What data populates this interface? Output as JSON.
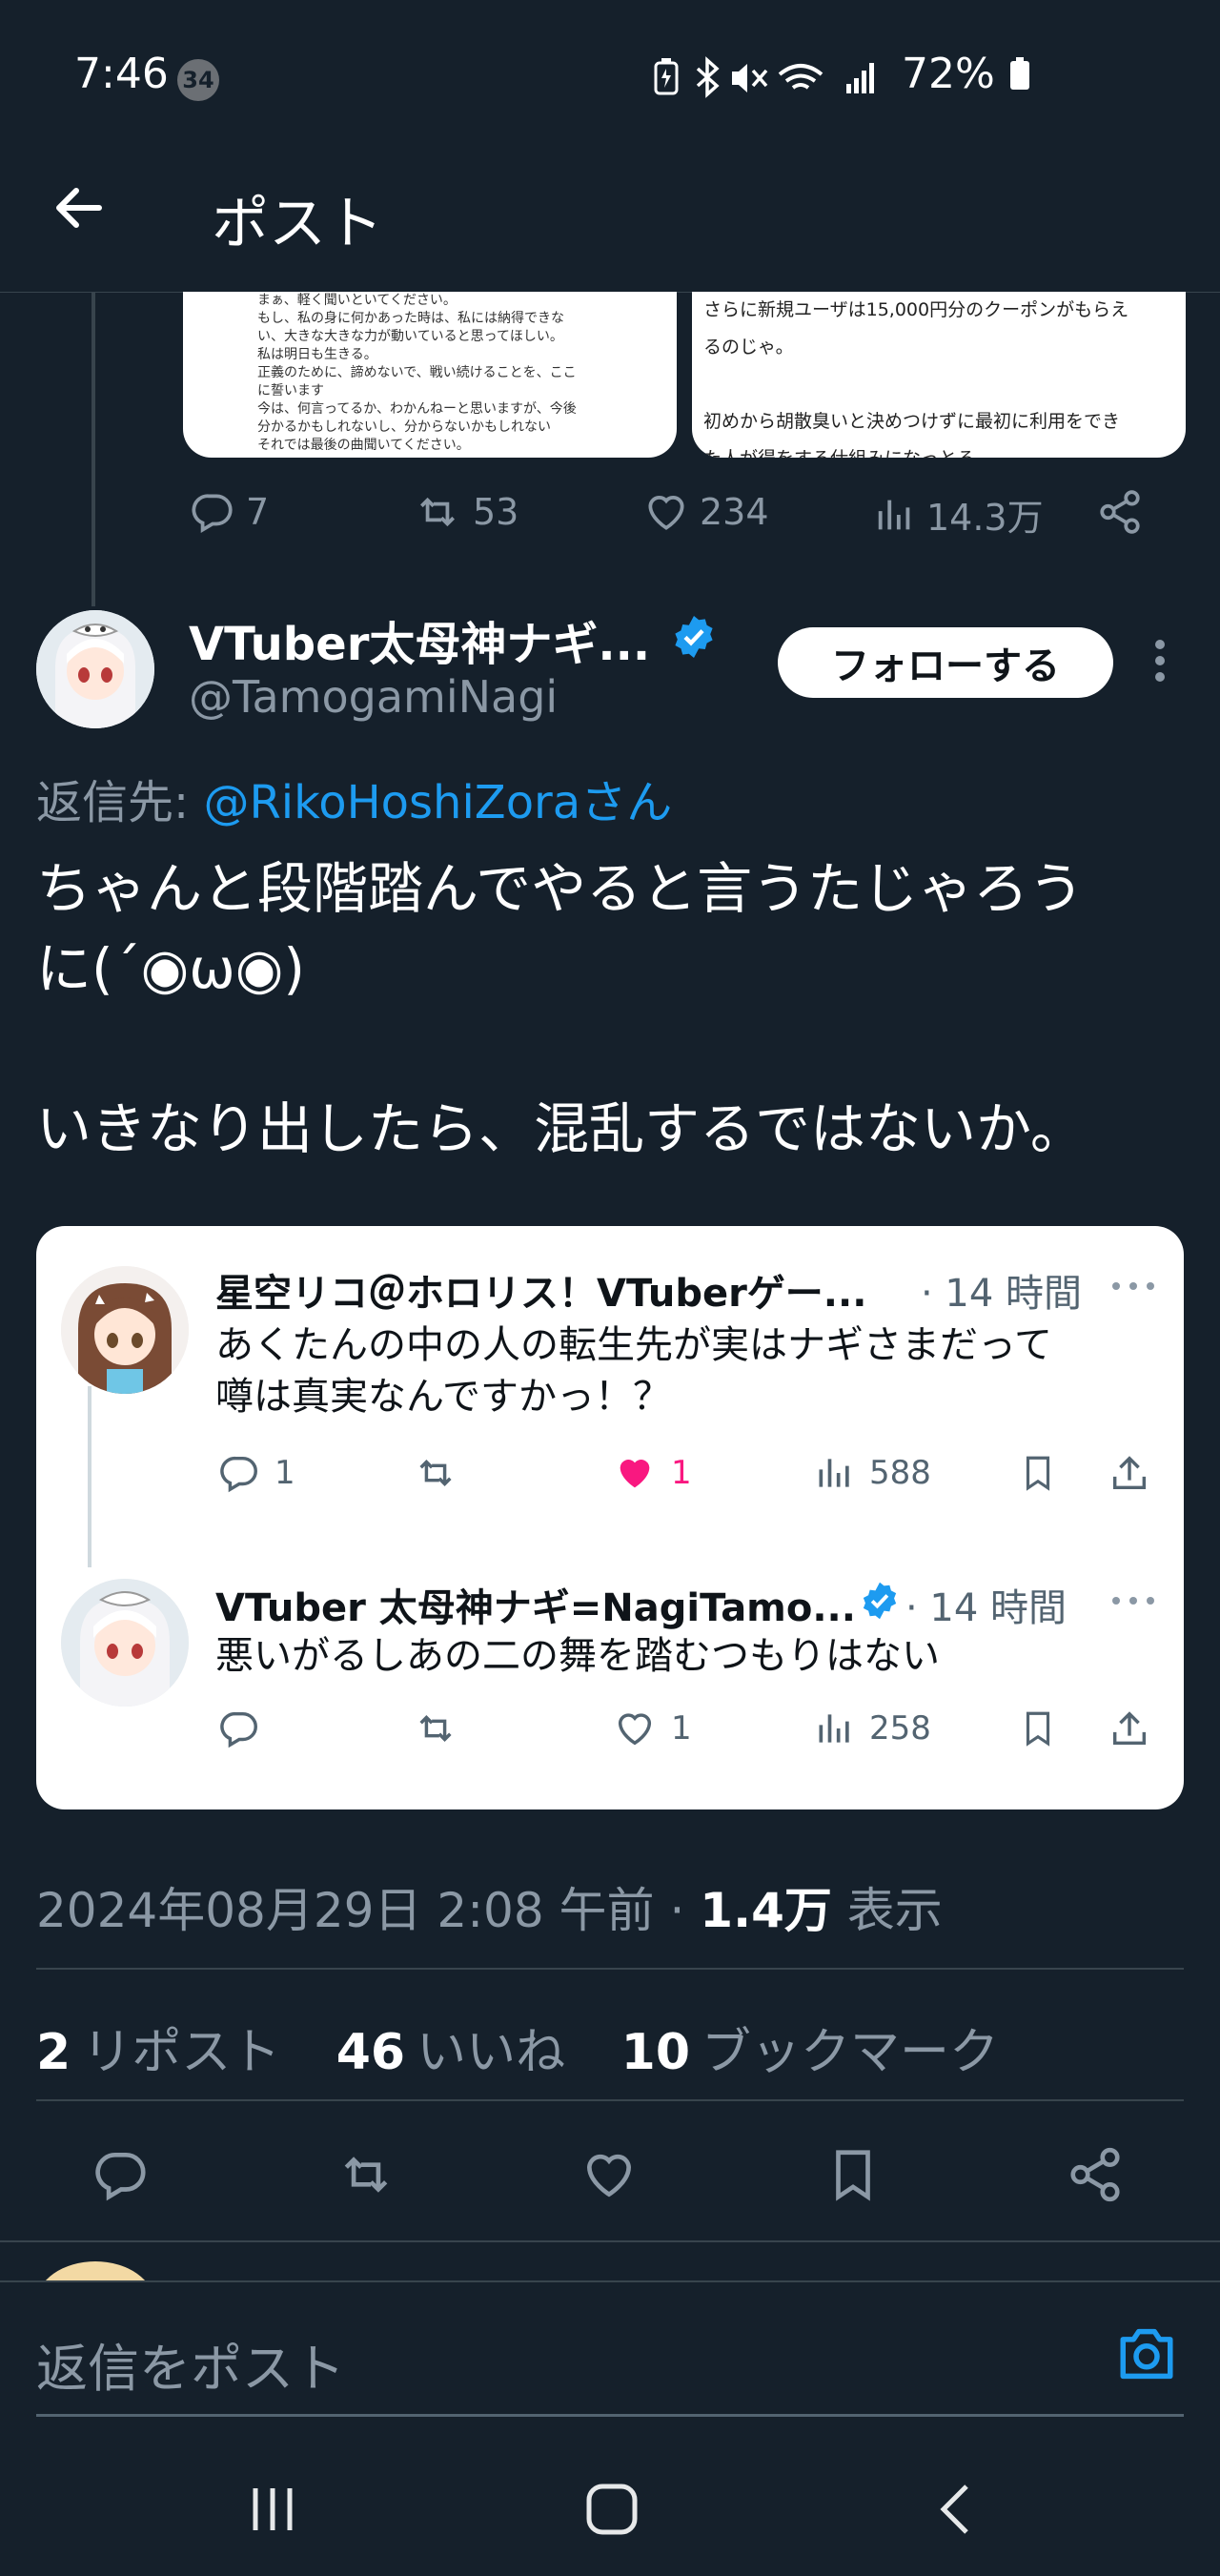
{
  "status_bar": {
    "time": "7:46",
    "notification_count": "34",
    "battery": "72%"
  },
  "header": {
    "title": "ポスト"
  },
  "previous_post": {
    "media_left_text": "まぁ、軽く聞いといてください。\nもし、私の身に何かあった時は、私には納得できな\nい、大きな大きな力が動いていると思ってほしい。\n私は明日も生きる。\n正義のために、諦めないで、戦い続けることを、ここ\nに誓います\n今は、何言ってるか、わかんねーと思いますが、今後\n分かるかもしれないし、分からないかもしれない\nそれでは最後の曲聞いてください。",
    "media_right_text": "さらに新規ユーザは15,000円分のクーポンがもらえ\nるのじゃ。\n\n初めから胡散臭いと決めつけずに最初に利用をでき\nた人が得をする仕組みになっとる。\nなんだかんだ言われたのにTikTokなんか稼ぎ頭は人",
    "replies": "7",
    "reposts": "53",
    "likes": "234",
    "views": "14.3万"
  },
  "author": {
    "name": "VTuber太母神ナギ...",
    "handle": "@TamogamiNagi",
    "follow_label": "フォローする"
  },
  "reply_to": {
    "prefix": "返信先: ",
    "target": "@RikoHoshiZoraさん"
  },
  "tweet": {
    "text": "ちゃんと段階踏んでやると言うたじゃろう\nに(´◉ω◉)\n\nいきなり出したら、混乱するではないか。",
    "date": "2024年08月29日 2:08 午前",
    "views_count": "1.4万",
    "views_label": "表示",
    "separator": "·"
  },
  "quoted_thread": [
    {
      "name": "星空リコ＠ホロリス！VTuberゲー...",
      "time": "· 14 時間",
      "text": "あくたんの中の人の転生先が実はナギさまだって\n噂は真実なんですかっ！？",
      "replies": "1",
      "reposts": "",
      "likes": "1",
      "views": "588"
    },
    {
      "name": "VTuber 太母神ナギ=NagiTamo...",
      "time": "· 14 時間",
      "text": "悪いがるしあの二の舞を踏むつもりはない",
      "replies": "",
      "reposts": "",
      "likes": "1",
      "views": "258"
    }
  ],
  "stats": {
    "reposts_count": "2",
    "reposts_label": "リポスト",
    "likes_count": "46",
    "likes_label": "いいね",
    "bookmarks_count": "10",
    "bookmarks_label": "ブックマーク"
  },
  "reply_bar": {
    "placeholder": "返信をポスト"
  },
  "colors": {
    "background": "#15202b",
    "accent": "#1d9bf0",
    "like_pink": "#f91880",
    "muted": "#8b98a5"
  },
  "icons": [
    "back-arrow-icon",
    "verified-badge-icon",
    "more-vertical-icon",
    "reply-icon",
    "repost-icon",
    "like-icon",
    "views-icon",
    "share-icon",
    "bookmark-icon",
    "upload-icon",
    "camera-icon",
    "recents-nav-icon",
    "home-nav-icon",
    "back-nav-icon"
  ]
}
